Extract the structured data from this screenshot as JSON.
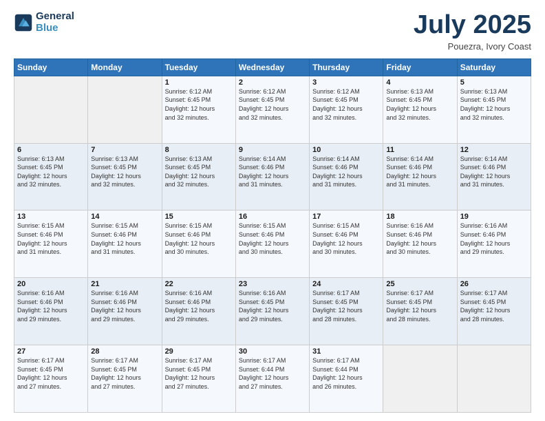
{
  "logo": {
    "line1": "General",
    "line2": "Blue"
  },
  "header": {
    "month": "July 2025",
    "location": "Pouezra, Ivory Coast"
  },
  "weekdays": [
    "Sunday",
    "Monday",
    "Tuesday",
    "Wednesday",
    "Thursday",
    "Friday",
    "Saturday"
  ],
  "weeks": [
    [
      {
        "day": "",
        "info": ""
      },
      {
        "day": "",
        "info": ""
      },
      {
        "day": "1",
        "info": "Sunrise: 6:12 AM\nSunset: 6:45 PM\nDaylight: 12 hours\nand 32 minutes."
      },
      {
        "day": "2",
        "info": "Sunrise: 6:12 AM\nSunset: 6:45 PM\nDaylight: 12 hours\nand 32 minutes."
      },
      {
        "day": "3",
        "info": "Sunrise: 6:12 AM\nSunset: 6:45 PM\nDaylight: 12 hours\nand 32 minutes."
      },
      {
        "day": "4",
        "info": "Sunrise: 6:13 AM\nSunset: 6:45 PM\nDaylight: 12 hours\nand 32 minutes."
      },
      {
        "day": "5",
        "info": "Sunrise: 6:13 AM\nSunset: 6:45 PM\nDaylight: 12 hours\nand 32 minutes."
      }
    ],
    [
      {
        "day": "6",
        "info": "Sunrise: 6:13 AM\nSunset: 6:45 PM\nDaylight: 12 hours\nand 32 minutes."
      },
      {
        "day": "7",
        "info": "Sunrise: 6:13 AM\nSunset: 6:45 PM\nDaylight: 12 hours\nand 32 minutes."
      },
      {
        "day": "8",
        "info": "Sunrise: 6:13 AM\nSunset: 6:45 PM\nDaylight: 12 hours\nand 32 minutes."
      },
      {
        "day": "9",
        "info": "Sunrise: 6:14 AM\nSunset: 6:46 PM\nDaylight: 12 hours\nand 31 minutes."
      },
      {
        "day": "10",
        "info": "Sunrise: 6:14 AM\nSunset: 6:46 PM\nDaylight: 12 hours\nand 31 minutes."
      },
      {
        "day": "11",
        "info": "Sunrise: 6:14 AM\nSunset: 6:46 PM\nDaylight: 12 hours\nand 31 minutes."
      },
      {
        "day": "12",
        "info": "Sunrise: 6:14 AM\nSunset: 6:46 PM\nDaylight: 12 hours\nand 31 minutes."
      }
    ],
    [
      {
        "day": "13",
        "info": "Sunrise: 6:15 AM\nSunset: 6:46 PM\nDaylight: 12 hours\nand 31 minutes."
      },
      {
        "day": "14",
        "info": "Sunrise: 6:15 AM\nSunset: 6:46 PM\nDaylight: 12 hours\nand 31 minutes."
      },
      {
        "day": "15",
        "info": "Sunrise: 6:15 AM\nSunset: 6:46 PM\nDaylight: 12 hours\nand 30 minutes."
      },
      {
        "day": "16",
        "info": "Sunrise: 6:15 AM\nSunset: 6:46 PM\nDaylight: 12 hours\nand 30 minutes."
      },
      {
        "day": "17",
        "info": "Sunrise: 6:15 AM\nSunset: 6:46 PM\nDaylight: 12 hours\nand 30 minutes."
      },
      {
        "day": "18",
        "info": "Sunrise: 6:16 AM\nSunset: 6:46 PM\nDaylight: 12 hours\nand 30 minutes."
      },
      {
        "day": "19",
        "info": "Sunrise: 6:16 AM\nSunset: 6:46 PM\nDaylight: 12 hours\nand 29 minutes."
      }
    ],
    [
      {
        "day": "20",
        "info": "Sunrise: 6:16 AM\nSunset: 6:46 PM\nDaylight: 12 hours\nand 29 minutes."
      },
      {
        "day": "21",
        "info": "Sunrise: 6:16 AM\nSunset: 6:46 PM\nDaylight: 12 hours\nand 29 minutes."
      },
      {
        "day": "22",
        "info": "Sunrise: 6:16 AM\nSunset: 6:46 PM\nDaylight: 12 hours\nand 29 minutes."
      },
      {
        "day": "23",
        "info": "Sunrise: 6:16 AM\nSunset: 6:45 PM\nDaylight: 12 hours\nand 29 minutes."
      },
      {
        "day": "24",
        "info": "Sunrise: 6:17 AM\nSunset: 6:45 PM\nDaylight: 12 hours\nand 28 minutes."
      },
      {
        "day": "25",
        "info": "Sunrise: 6:17 AM\nSunset: 6:45 PM\nDaylight: 12 hours\nand 28 minutes."
      },
      {
        "day": "26",
        "info": "Sunrise: 6:17 AM\nSunset: 6:45 PM\nDaylight: 12 hours\nand 28 minutes."
      }
    ],
    [
      {
        "day": "27",
        "info": "Sunrise: 6:17 AM\nSunset: 6:45 PM\nDaylight: 12 hours\nand 27 minutes."
      },
      {
        "day": "28",
        "info": "Sunrise: 6:17 AM\nSunset: 6:45 PM\nDaylight: 12 hours\nand 27 minutes."
      },
      {
        "day": "29",
        "info": "Sunrise: 6:17 AM\nSunset: 6:45 PM\nDaylight: 12 hours\nand 27 minutes."
      },
      {
        "day": "30",
        "info": "Sunrise: 6:17 AM\nSunset: 6:44 PM\nDaylight: 12 hours\nand 27 minutes."
      },
      {
        "day": "31",
        "info": "Sunrise: 6:17 AM\nSunset: 6:44 PM\nDaylight: 12 hours\nand 26 minutes."
      },
      {
        "day": "",
        "info": ""
      },
      {
        "day": "",
        "info": ""
      }
    ]
  ]
}
